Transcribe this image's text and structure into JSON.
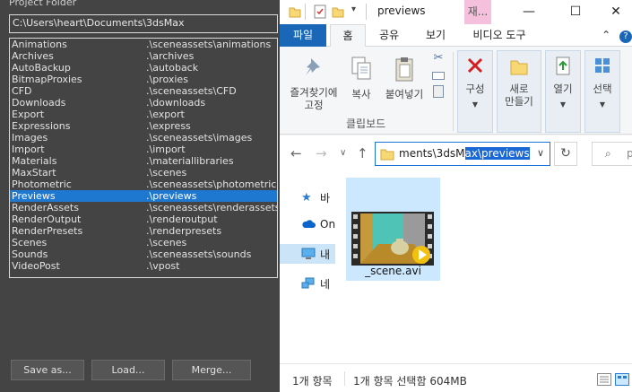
{
  "max_dialog": {
    "title": "Project Folder",
    "path": "C:\\Users\\heart\\Documents\\3dsMax",
    "folders": [
      {
        "name": "Animations",
        "path": ".\\sceneassets\\animations"
      },
      {
        "name": "Archives",
        "path": ".\\archives"
      },
      {
        "name": "AutoBackup",
        "path": ".\\autoback"
      },
      {
        "name": "BitmapProxies",
        "path": ".\\proxies"
      },
      {
        "name": "CFD",
        "path": ".\\sceneassets\\CFD"
      },
      {
        "name": "Downloads",
        "path": ".\\downloads"
      },
      {
        "name": "Export",
        "path": ".\\export"
      },
      {
        "name": "Expressions",
        "path": ".\\express"
      },
      {
        "name": "Images",
        "path": ".\\sceneassets\\images"
      },
      {
        "name": "Import",
        "path": ".\\import"
      },
      {
        "name": "Materials",
        "path": ".\\materiallibraries"
      },
      {
        "name": "MaxStart",
        "path": ".\\scenes"
      },
      {
        "name": "Photometric",
        "path": ".\\sceneassets\\photometric"
      },
      {
        "name": "Previews",
        "path": ".\\previews"
      },
      {
        "name": "RenderAssets",
        "path": ".\\sceneassets\\renderassets"
      },
      {
        "name": "RenderOutput",
        "path": ".\\renderoutput"
      },
      {
        "name": "RenderPresets",
        "path": ".\\renderpresets"
      },
      {
        "name": "Scenes",
        "path": ".\\scenes"
      },
      {
        "name": "Sounds",
        "path": ".\\sceneassets\\sounds"
      },
      {
        "name": "VideoPost",
        "path": ".\\vpost"
      }
    ],
    "selected_folder": "Previews",
    "buttons": {
      "save_as": "Save as...",
      "load": "Load...",
      "merge": "Merge..."
    }
  },
  "explorer": {
    "window_title": "previews",
    "tool_tab_short": "재...",
    "window_controls": {
      "minimize": "—",
      "maximize": "☐",
      "close": "✕"
    },
    "tabs": {
      "file": "파일",
      "home": "홈",
      "share": "공유",
      "view": "보기",
      "video_tools": "비디오 도구"
    },
    "help": "?",
    "ribbon": {
      "pin_label": "즐겨찾기에\n고정",
      "copy_label": "복사",
      "paste_label": "붙여넣기",
      "clipboard_group": "클립보드",
      "organize_label": "구성",
      "new_folder_label": "새로\n만들기",
      "open_label": "열기",
      "select_label": "선택"
    },
    "address": {
      "prefix": "ments\\3dsM",
      "selected": "ax\\previews"
    },
    "search_placeholder": "p",
    "nav_items": [
      {
        "label": "바",
        "icon": "star-icon"
      },
      {
        "label": "On",
        "icon": "cloud-icon"
      },
      {
        "label": "내",
        "icon": "pc-icon"
      },
      {
        "label": "네",
        "icon": "network-icon"
      }
    ],
    "file": {
      "name": "_scene.avi"
    },
    "status": {
      "items": "1개 항목",
      "selected": "1개 항목 선택함 604MB"
    },
    "colors": {
      "accent": "#1a67b8",
      "selection": "#1e78d0",
      "tile": "#cce8ff"
    }
  }
}
